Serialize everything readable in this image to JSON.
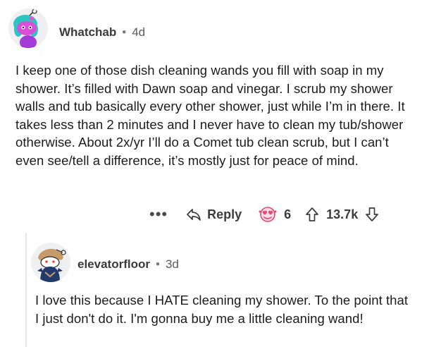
{
  "comments": [
    {
      "username": "Whatchab",
      "age": "4d",
      "separator": "•",
      "body": "I keep one of those dish cleaning wands you fill with soap in my shower. It’s filled with Dawn soap and vinegar. I scrub my shower walls and tub basically every other shower, just while I’m in there. It takes less than 2 minutes and I never have to clean my tub/shower otherwise. About 2x/yr I’ll do a Comet tub clean scrub, but I can’t even see/tell a difference, it’s mostly just for peace of mind.",
      "actions": {
        "more": "•••",
        "reply_label": "Reply",
        "award_count": "6",
        "score": "13.7k"
      }
    },
    {
      "username": "elevatorfloor",
      "age": "3d",
      "separator": "•",
      "body": "I love this because I HATE cleaning my shower. To the point that I just don't do it. I'm gonna buy me a little cleaning wand!"
    }
  ],
  "icons": {
    "reply": "reply-arrow-icon",
    "award": "heart-eyes-award-icon",
    "upvote": "upvote-arrow-icon",
    "downvote": "downvote-arrow-icon"
  },
  "colors": {
    "text": "#1c1c1e",
    "meta": "#5c5c5e",
    "award_pink": "#e8466f"
  }
}
